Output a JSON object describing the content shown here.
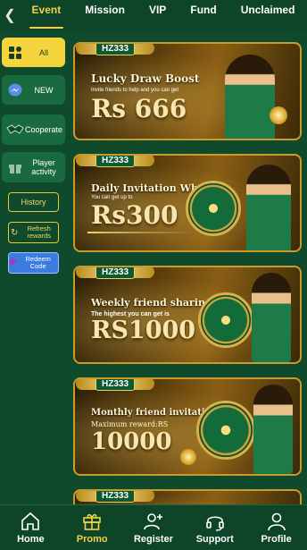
{
  "header": {
    "tabs": [
      {
        "label": "Event",
        "active": true
      },
      {
        "label": "Mission"
      },
      {
        "label": "VIP"
      },
      {
        "label": "Fund"
      },
      {
        "label": "Unclaimed"
      }
    ]
  },
  "sidebar": {
    "items": [
      {
        "label": "All",
        "icon": "grid-icon",
        "active": true
      },
      {
        "label": "NEW",
        "icon": "messenger-icon"
      },
      {
        "label": "Cooperate",
        "icon": "handshake-icon"
      },
      {
        "label": "Player activity",
        "icon": "gift-icon"
      }
    ],
    "history_label": "History",
    "refresh_label": "Refresh rewards",
    "redeem_label": "Redeem Code"
  },
  "banners": [
    {
      "logo": "HZ333",
      "title": "Lucky Draw Boost",
      "subtitle": "Invite friends to help and you can get",
      "amount": "Rs 666"
    },
    {
      "logo": "HZ333",
      "title": "Daily Invitation Wheel",
      "subtitle": "You can get up to",
      "amount": "Rs300"
    },
    {
      "logo": "HZ333",
      "title": "Weekly friend sharing",
      "subtitle": "The highest you can get is",
      "amount": "RS1000"
    },
    {
      "logo": "HZ333",
      "title": "Monthly friend invitations",
      "subtitle": "Maximum reward:RS",
      "amount": "10000"
    },
    {
      "logo": "HZ333"
    }
  ],
  "bottom_nav": [
    {
      "label": "Home",
      "icon": "home-icon"
    },
    {
      "label": "Promo",
      "icon": "gift-icon",
      "active": true
    },
    {
      "label": "Register",
      "icon": "add-user-icon"
    },
    {
      "label": "Support",
      "icon": "headset-icon"
    },
    {
      "label": "Profile",
      "icon": "user-icon"
    }
  ],
  "colors": {
    "background": "#0f4a2c",
    "accent": "#f3d24a",
    "banner_border": "#c99b2e"
  }
}
